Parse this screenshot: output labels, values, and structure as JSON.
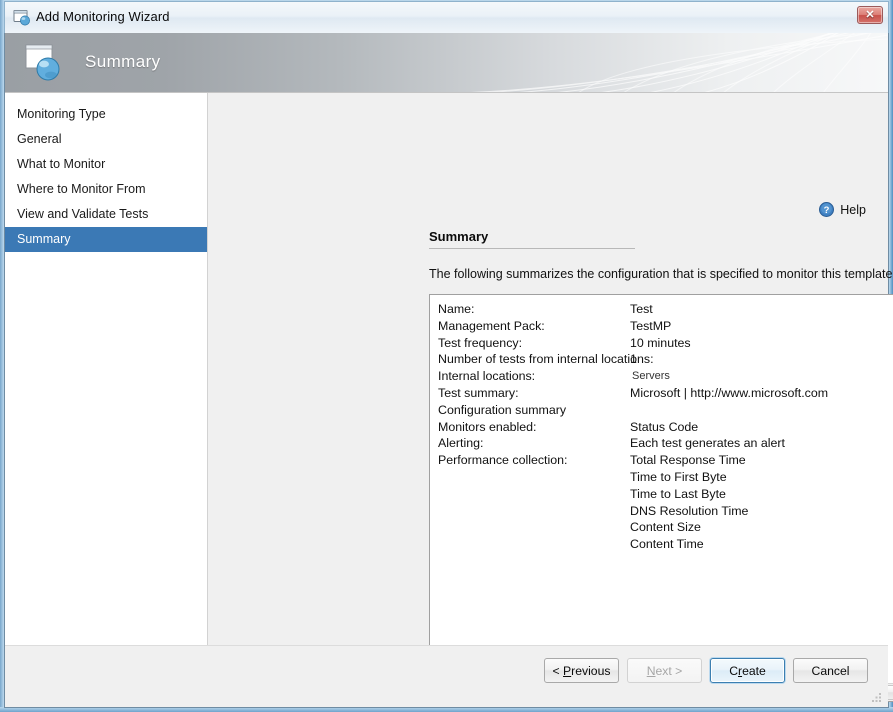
{
  "window": {
    "title": "Add Monitoring Wizard",
    "title_icon": "wizard-window-icon",
    "close_label": "✕",
    "frame_color": "#bcd9ee"
  },
  "header": {
    "title": "Summary",
    "icon": "page-globe-icon",
    "accent": "#9a9fa4"
  },
  "sidebar": {
    "items": [
      {
        "label": "Monitoring Type",
        "selected": false
      },
      {
        "label": "General",
        "selected": false
      },
      {
        "label": "What to Monitor",
        "selected": false
      },
      {
        "label": "Where to Monitor From",
        "selected": false
      },
      {
        "label": "View and Validate Tests",
        "selected": false
      },
      {
        "label": "Summary",
        "selected": true
      }
    ],
    "selected_color": "#3b79b5"
  },
  "content": {
    "help": {
      "label": "Help",
      "icon": "help-question-icon"
    },
    "section_title": "Summary",
    "intro": "The following summarizes the configuration that is specified to monitor this template.",
    "summary_rows": [
      {
        "label": "Name:",
        "value": "Test",
        "small": false
      },
      {
        "label": "Management Pack:",
        "value": "TestMP",
        "small": false
      },
      {
        "label": "Test frequency:",
        "value": "10 minutes",
        "small": false
      },
      {
        "label": "Number of tests from internal locations:",
        "value": "1",
        "small": false
      },
      {
        "label": "Internal locations:",
        "value": "Servers",
        "small": true
      },
      {
        "label": "Test summary:",
        "value": "Microsoft | http://www.microsoft.com",
        "small": false
      },
      {
        "label": "Configuration summary",
        "value": "",
        "small": false
      },
      {
        "label": "Monitors enabled:",
        "value": "Status Code",
        "small": false
      },
      {
        "label": "Alerting:",
        "value": "Each test generates an alert",
        "small": false
      },
      {
        "label": "Performance collection:",
        "value": "Total Response Time",
        "small": false
      },
      {
        "label": "",
        "value": "Time to First Byte",
        "small": false
      },
      {
        "label": "",
        "value": "Time to Last Byte",
        "small": false
      },
      {
        "label": "",
        "value": "DNS Resolution Time",
        "small": false
      },
      {
        "label": "",
        "value": "Content Size",
        "small": false
      },
      {
        "label": "",
        "value": "Content Time",
        "small": false
      }
    ],
    "scrollbar": {
      "left_arrow": "chevron-left-icon",
      "right_arrow": "chevron-right-icon"
    }
  },
  "footer": {
    "buttons": [
      {
        "name": "previous",
        "prefix": "< ",
        "accel": "P",
        "rest": "revious",
        "state": "enabled"
      },
      {
        "name": "next",
        "prefix": "",
        "accel": "N",
        "rest": "ext >",
        "state": "disabled"
      },
      {
        "name": "create",
        "prefix": "",
        "accel": "r",
        "rest": "eate",
        "pre_accel": "C",
        "state": "focused"
      },
      {
        "name": "cancel",
        "prefix": "",
        "accel": "",
        "rest": "Cancel",
        "state": "enabled"
      }
    ]
  }
}
